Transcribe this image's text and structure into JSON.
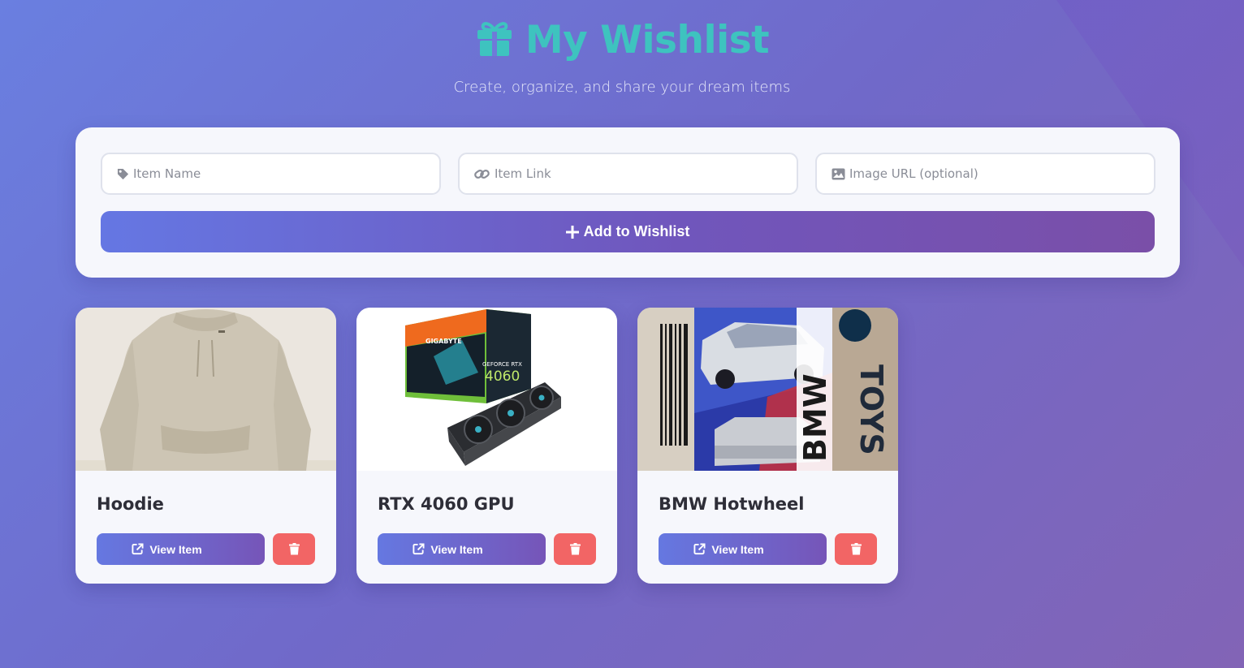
{
  "header": {
    "title": "My Wishlist",
    "subtitle": "Create, organize, and share your dream items",
    "icon": "gift-icon",
    "accent_color": "#3ec3bf"
  },
  "form": {
    "item_name_placeholder": "Item Name",
    "item_link_placeholder": "Item Link",
    "image_url_placeholder": "Image URL (optional)",
    "add_button_label": "Add to Wishlist"
  },
  "items": [
    {
      "name": "Hoodie",
      "view_label": "View Item"
    },
    {
      "name": "RTX 4060 GPU",
      "view_label": "View Item"
    },
    {
      "name": "BMW Hotwheel",
      "view_label": "View Item"
    }
  ],
  "gpu_box": {
    "brand": "GIGABYTE",
    "product": "GEFORCE RTX",
    "model": "4060"
  },
  "car_box": {
    "side_text": "TOYS",
    "back_text": "BMW"
  },
  "colors": {
    "delete": "#f26565",
    "primary_start": "#6577e3",
    "primary_end": "#7a4fa8"
  }
}
